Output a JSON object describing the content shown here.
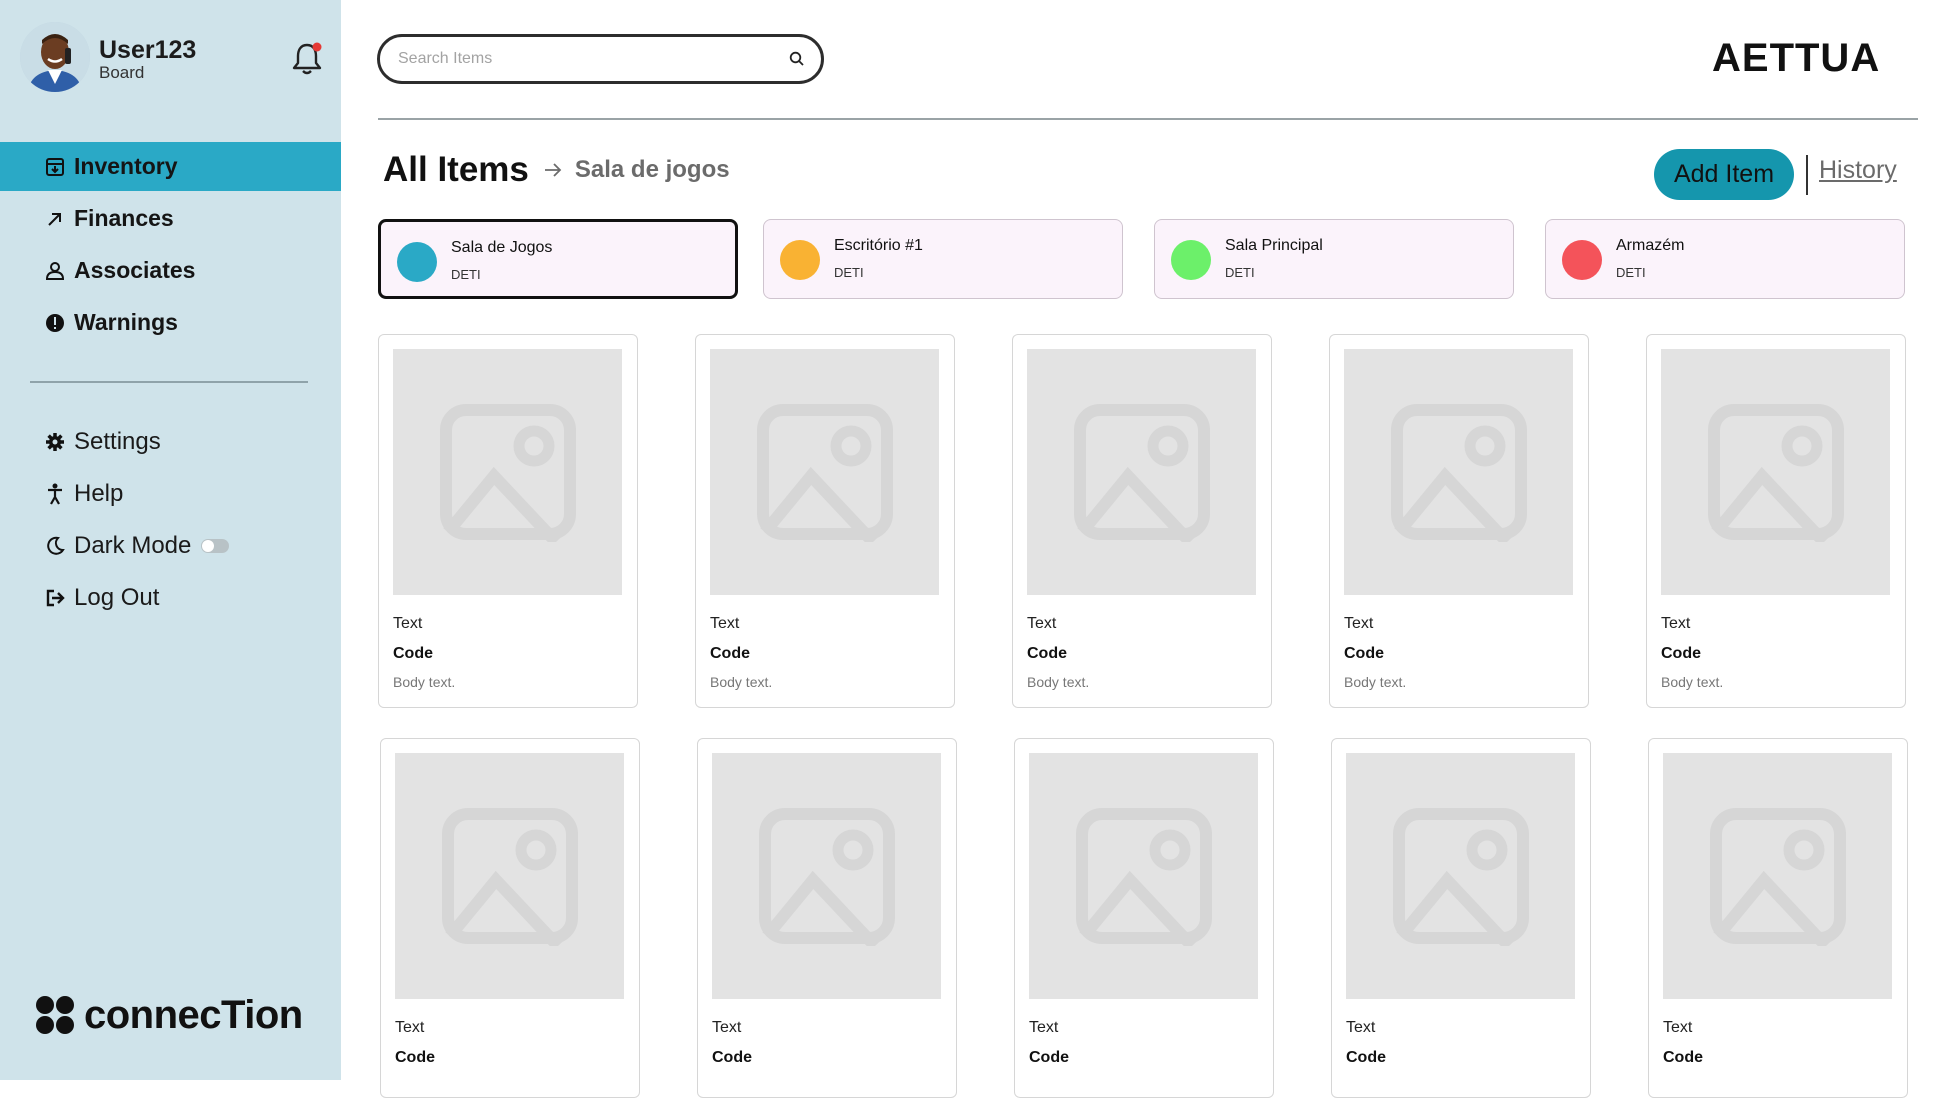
{
  "user": {
    "name": "User123",
    "role": "Board"
  },
  "nav": {
    "items": [
      {
        "label": "Inventory",
        "icon": "inventory-icon",
        "active": true
      },
      {
        "label": "Finances",
        "icon": "arrow-up-right-icon",
        "active": false
      },
      {
        "label": "Associates",
        "icon": "person-icon",
        "active": false
      },
      {
        "label": "Warnings",
        "icon": "alert-icon",
        "active": false
      }
    ],
    "secondary": [
      {
        "label": "Settings",
        "icon": "gear-icon"
      },
      {
        "label": "Help",
        "icon": "help-person-icon"
      },
      {
        "label": "Dark Mode",
        "icon": "moon-icon",
        "toggle": false
      },
      {
        "label": "Log Out",
        "icon": "logout-icon"
      }
    ]
  },
  "brand": {
    "name": "connecTion"
  },
  "search": {
    "placeholder": "Search Items",
    "value": ""
  },
  "header": {
    "logo": "AETTUA"
  },
  "page": {
    "title": "All Items",
    "breadcrumb": "Sala de jogos",
    "add_label": "Add Item",
    "history_label": "History"
  },
  "locations": [
    {
      "name": "Sala de Jogos",
      "sub": "DETI",
      "color": "#2aa9c6",
      "active": true
    },
    {
      "name": "Escritório #1",
      "sub": "DETI",
      "color": "#f9b233",
      "active": false
    },
    {
      "name": "Sala Principal",
      "sub": "DETI",
      "color": "#6cf06a",
      "active": false
    },
    {
      "name": "Armazém",
      "sub": "DETI",
      "color": "#f4535a",
      "active": false
    }
  ],
  "items": [
    {
      "text": "Text",
      "code": "Code",
      "body": "Body text."
    },
    {
      "text": "Text",
      "code": "Code",
      "body": "Body text."
    },
    {
      "text": "Text",
      "code": "Code",
      "body": "Body text."
    },
    {
      "text": "Text",
      "code": "Code",
      "body": "Body text."
    },
    {
      "text": "Text",
      "code": "Code",
      "body": "Body text."
    },
    {
      "text": "Text",
      "code": "Code",
      "body": ""
    },
    {
      "text": "Text",
      "code": "Code",
      "body": ""
    },
    {
      "text": "Text",
      "code": "Code",
      "body": ""
    },
    {
      "text": "Text",
      "code": "Code",
      "body": ""
    },
    {
      "text": "Text",
      "code": "Code",
      "body": ""
    }
  ],
  "colors": {
    "sidebar_bg": "#cfe3ea",
    "accent": "#2aa9c6",
    "button": "#1596ad",
    "notification_dot": "#e53935"
  }
}
